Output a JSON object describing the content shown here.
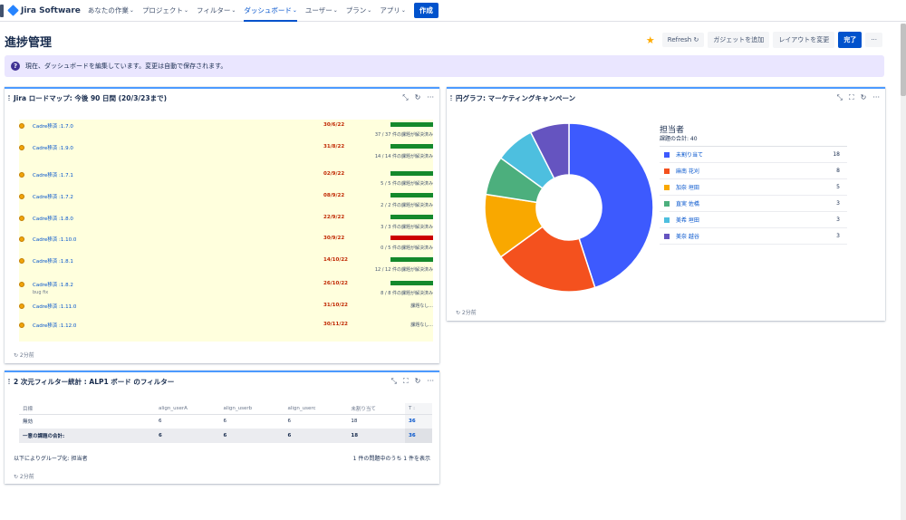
{
  "nav": {
    "product": "Jira Software",
    "items": [
      {
        "label": "あなたの作業",
        "chev": "⌄"
      },
      {
        "label": "プロジェクト",
        "chev": "⌄"
      },
      {
        "label": "フィルター",
        "chev": "⌄"
      },
      {
        "label": "ダッシュボード",
        "chev": "⌄"
      },
      {
        "label": "ユーザー",
        "chev": "⌄"
      },
      {
        "label": "プラン",
        "chev": "⌄"
      },
      {
        "label": "アプリ",
        "chev": "⌄"
      }
    ],
    "create": "作成"
  },
  "header": {
    "title": "進捗管理",
    "refresh": "Refresh ↻",
    "add_gadget": "ガジェットを追加",
    "change_layout": "レイアウトを変更",
    "done": "完了",
    "more": "···"
  },
  "banner": {
    "text": "現在、ダッシュボードを編集しています。変更は自動で保存されます。",
    "icon": "?"
  },
  "roadmap": {
    "title": "Jira ロードマップ: 今後 90 日間 (20/3/23まで)",
    "updated": "↻ 2分前",
    "rows": [
      {
        "name": "Cadre移済 :1.7.0",
        "sub": "",
        "date": "30/6/22",
        "status": "37 / 37 件の課題が解決済み",
        "bar": "green"
      },
      {
        "name": "Cadre移済 :1.9.0",
        "sub": "",
        "date": "31/8/22",
        "status": "14 / 14 件の課題が解決済み",
        "bar": "green"
      },
      {
        "name": "Cadre移済 :1.7.1",
        "sub": "",
        "date": "02/9/22",
        "status": "5 / 5 件の課題が解決済み",
        "bar": "green"
      },
      {
        "name": "Cadre移済 :1.7.2",
        "sub": "",
        "date": "08/9/22",
        "status": "2 / 2 件の課題が解決済み",
        "bar": "green"
      },
      {
        "name": "Cadre移済 :1.8.0",
        "sub": "",
        "date": "22/9/22",
        "status": "3 / 3 件の課題が解決済み",
        "bar": "green"
      },
      {
        "name": "Cadre移済 :1.10.0",
        "sub": "",
        "date": "30/9/22",
        "status": "0 / 5 件の課題が解決済み",
        "bar": "red"
      },
      {
        "name": "Cadre移済 :1.8.1",
        "sub": "",
        "date": "14/10/22",
        "status": "12 / 12 件の課題が解決済み",
        "bar": "green"
      },
      {
        "name": "Cadre移済 :1.8.2",
        "sub": "bug fix",
        "date": "26/10/22",
        "status": "8 / 8 件の課題が解決済み",
        "bar": "green"
      },
      {
        "name": "Cadre移済 :1.11.0",
        "sub": "",
        "date": "31/10/22",
        "status": "課題なし...",
        "bar": "none"
      },
      {
        "name": "Cadre移済 :1.12.0",
        "sub": "",
        "date": "30/11/22",
        "status": "課題なし...",
        "bar": "none"
      }
    ]
  },
  "pie": {
    "title": "円グラフ: マーケティングキャンペーン",
    "legend_title": "担当者",
    "legend_sub": "課題の合計: 40",
    "updated": "↻ 2分前"
  },
  "chart_data": {
    "type": "pie",
    "title": "担当者",
    "total": 40,
    "slices": [
      {
        "name": "未割り当て",
        "value": 18,
        "color": "#3d5afe"
      },
      {
        "name": "麻南 花刈",
        "value": 8,
        "color": "#f4511e"
      },
      {
        "name": "加奈 垣田",
        "value": 5,
        "color": "#f9a800"
      },
      {
        "name": "直実 佐橋",
        "value": 3,
        "color": "#4caf7d"
      },
      {
        "name": "美希 垣田",
        "value": 3,
        "color": "#4dbfdf"
      },
      {
        "name": "美奈 越谷",
        "value": 3,
        "color": "#6554c0"
      }
    ],
    "donut": true
  },
  "filter": {
    "title": "2 次元フィルター統計 : ALP1 ボード のフィルター",
    "headers": [
      "目標",
      "align_userA",
      "align_userb",
      "align_userc",
      "未割り当て",
      "T :"
    ],
    "rows": [
      [
        "無効",
        "6",
        "6",
        "6",
        "18",
        "36"
      ]
    ],
    "total_row": [
      "一意の課題の合計:",
      "6",
      "6",
      "6",
      "18",
      "36"
    ],
    "group_by": "以下によりグループ化: 担当者",
    "count": "1 件の問題中のうち 1 件を表示",
    "updated": "↻ 2分前"
  },
  "tools": {
    "minimize": "⤡",
    "refresh": "↻",
    "more": "···",
    "maximize": "⛶"
  }
}
